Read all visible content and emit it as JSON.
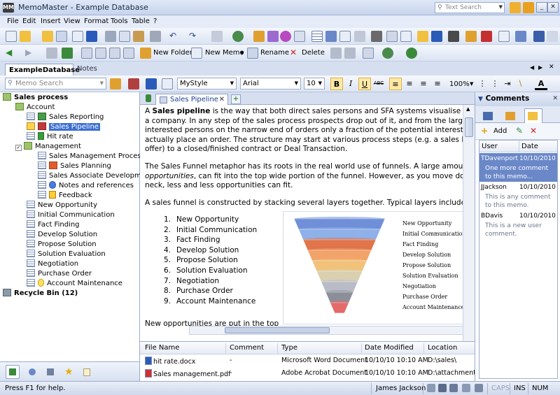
{
  "app": {
    "title": "MemoMaster - Example Database"
  },
  "title_search": {
    "placeholder": "Text Search"
  },
  "menu": [
    "File",
    "Edit",
    "Insert",
    "View",
    "Format",
    "Tools",
    "Table",
    "?"
  ],
  "toolbar2": {
    "new_folder": "New Folder",
    "new_memo": "New Memo",
    "rename": "Rename",
    "delete": "Delete"
  },
  "panel_tabs": {
    "active": "ExampleDatabase",
    "other": "Notes"
  },
  "format_bar": {
    "memo_search_placeholder": "Memo Search",
    "style": "MyStyle",
    "font": "Arial",
    "size": "10",
    "zoom": "100%"
  },
  "tree": {
    "root": "Sales process",
    "items": [
      {
        "label": "Account"
      },
      {
        "label": "Sales Reporting"
      },
      {
        "label": "Sales Pipeline"
      },
      {
        "label": "Hit rate"
      },
      {
        "label": "Management"
      },
      {
        "label": "Sales Management Process"
      },
      {
        "label": "Sales Planning"
      },
      {
        "label": "Sales Associate Development"
      },
      {
        "label": "Notes and references"
      },
      {
        "label": "Feedback"
      },
      {
        "label": "New Opportunity"
      },
      {
        "label": "Initial Communication"
      },
      {
        "label": "Fact Finding"
      },
      {
        "label": "Develop Solution"
      },
      {
        "label": "Propose Solution"
      },
      {
        "label": "Solution Evaluation"
      },
      {
        "label": "Negotiation"
      },
      {
        "label": "Purchase Order"
      },
      {
        "label": "Account Maintenance"
      }
    ],
    "recycle": "Recycle Bin (12)"
  },
  "doc_tab": {
    "label": "Sales Pipeline"
  },
  "editor": {
    "p1_a": "A ",
    "p1_bold": "Sales pipeline",
    "p1_b": " is the way that both direct sales persons and SFA systems visualise the",
    "p1_l2": "a company. In any step of the sales process prospects drop out of it, and from the large n",
    "p1_l3": "interested persons on the narrow end of orders only a fraction of the potential interested pe",
    "p1_l4": "actually place an order. The structure may start at various process steps (e.g. a sales lea",
    "p1_l5": "offer) to a closed/finished contract or Deal Transaction.",
    "p2_l1": "The Sales Funnel metaphor has its roots in the real world use of funnels. A large amount",
    "p2_l2_it": "opportunities",
    "p2_l2": ", can fit into the top wide portion of the funnel. However, as you move down t",
    "p2_l3": "neck, less and less opportunities can fit.",
    "p3": "A sales funnel is constructed by stacking several layers together. Typical layers include:",
    "list": [
      "New Opportunity",
      "Initial Communication",
      "Fact Finding",
      "Develop Solution",
      "Propose Solution",
      "Solution Evaluation",
      "Negotiation",
      "Purchase Order",
      "Account Maintenance"
    ],
    "p4": "New opportunities are put in the top"
  },
  "funnel": {
    "labels": [
      "New Opportunity",
      "Initial Communication",
      "Fact Finding",
      "Develop Solution",
      "Propose Solution",
      "Solution Evaluation",
      "Negotiation",
      "Purchase Order",
      "Account Maintenance"
    ],
    "colors": [
      "#6f8fd9",
      "#8fb0e8",
      "#e0744a",
      "#f2a36a",
      "#f1c27a",
      "#d9d0b0",
      "#b9bcc6",
      "#8c8f9a",
      "#e56a6a"
    ]
  },
  "files": {
    "headers": [
      "File Name",
      "Comment",
      "Type",
      "Date Modified",
      "Location"
    ],
    "rows": [
      {
        "name": "hit rate.docx",
        "comment": "-",
        "type": "Microsoft Word Document",
        "date": "10/10/10 10:10 AM",
        "loc": "D:\\sales\\"
      },
      {
        "name": "Sales management.pdf",
        "comment": "-",
        "type": "Adobe Acrobat Document",
        "date": "10/10/10 10:10 AM",
        "loc": "D:\\attachment\\"
      }
    ]
  },
  "comments": {
    "title": "Comments",
    "add": "Add",
    "headers": [
      "User",
      "Date"
    ],
    "rows": [
      {
        "user": "TDavenport",
        "date": "10/10/2010",
        "text": "One more comment to this memo..."
      },
      {
        "user": "JJackson",
        "date": "10/10/2010",
        "text": "This is any comment to this memo."
      },
      {
        "user": "BDavis",
        "date": "10/10/2010",
        "text": "This is a new user comment."
      }
    ]
  },
  "status": {
    "help": "Press F1 for help.",
    "user": "James Jackson",
    "caps": "CAPS",
    "ins": "INS",
    "num": "NUM"
  }
}
